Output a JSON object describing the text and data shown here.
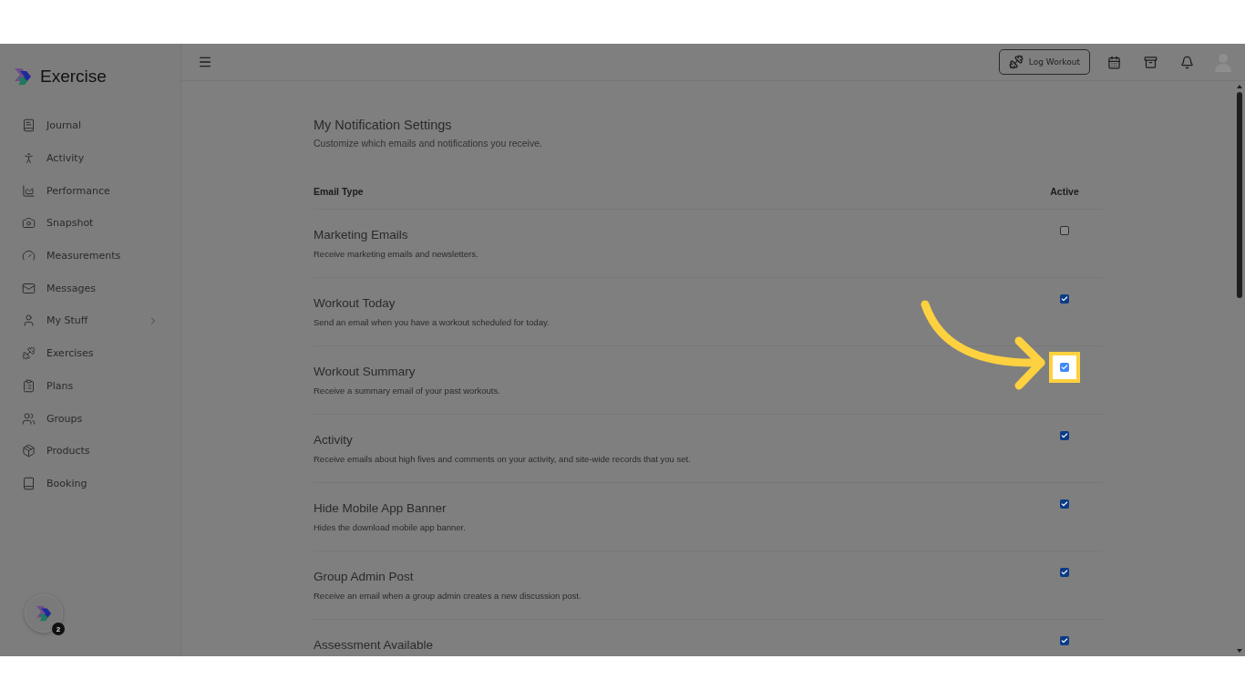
{
  "app": {
    "name": "Exercise"
  },
  "sidebar": {
    "items": [
      {
        "label": "Journal",
        "expandable": false
      },
      {
        "label": "Activity",
        "expandable": false
      },
      {
        "label": "Performance",
        "expandable": false
      },
      {
        "label": "Snapshot",
        "expandable": false
      },
      {
        "label": "Measurements",
        "expandable": false
      },
      {
        "label": "Messages",
        "expandable": false
      },
      {
        "label": "My Stuff",
        "expandable": true
      },
      {
        "label": "Exercises",
        "expandable": false
      },
      {
        "label": "Plans",
        "expandable": false
      },
      {
        "label": "Groups",
        "expandable": false
      },
      {
        "label": "Products",
        "expandable": false
      },
      {
        "label": "Booking",
        "expandable": false
      }
    ],
    "chat_badge": "2"
  },
  "topbar": {
    "log_button": "Log Workout"
  },
  "settings": {
    "title": "My Notification Settings",
    "subtitle": "Customize which emails and notifications you receive.",
    "columns": [
      "Email Type",
      "Active"
    ],
    "rows": [
      {
        "title": "Marketing Emails",
        "description": "Receive marketing emails and newsletters.",
        "checked": false,
        "highlighted": false
      },
      {
        "title": "Workout Today",
        "description": "Send an email when you have a workout scheduled for today.",
        "checked": true,
        "highlighted": false
      },
      {
        "title": "Workout Summary",
        "description": "Receive a summary email of your past workouts.",
        "checked": true,
        "highlighted": true
      },
      {
        "title": "Activity",
        "description": "Receive emails about high fives and comments on your activity, and site-wide records that you set.",
        "checked": true,
        "highlighted": false
      },
      {
        "title": "Hide Mobile App Banner",
        "description": "Hides the download mobile app banner.",
        "checked": true,
        "highlighted": false
      },
      {
        "title": "Group Admin Post",
        "description": "Receive an email when a group admin creates a new discussion post.",
        "checked": true,
        "highlighted": false
      },
      {
        "title": "Assessment Available",
        "checked": true,
        "highlighted": false
      }
    ]
  }
}
